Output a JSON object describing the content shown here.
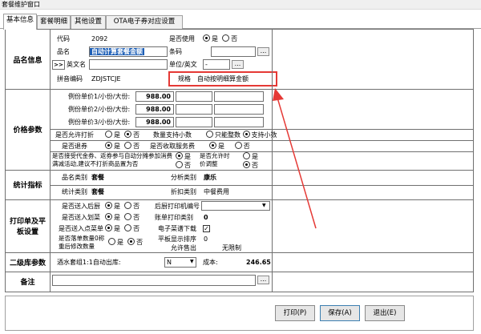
{
  "window": {
    "title": "套餐维护窗口"
  },
  "tabs": [
    "基本信息",
    "套餐明细",
    "其他设置",
    "OTA电子券对应设置"
  ],
  "sections": {
    "product": "品名信息",
    "price": "价格参数",
    "stats": "统计指标",
    "print": "打印单及平板设置",
    "stock": "二级库参数",
    "remark": "备注"
  },
  "product": {
    "code_label": "代码",
    "code_value": "2092",
    "name_label": "品名",
    "name_value": "自动计算套餐金额",
    "en_btn": ">>",
    "en_label": "英文名",
    "pinyin_label": "拼音编码",
    "pinyin_value": "ZDJSTCJE",
    "active_label": "是否使用",
    "active_yes": "是",
    "active_no": "否",
    "barcode_label": "条码",
    "unit_label": "单位/英文",
    "unit_value": "-",
    "spec_label": "规格",
    "spec_value": "自动按明细算金额"
  },
  "price": {
    "p1_label": "例份单价1/小份/大份:",
    "p1_value": "988.00",
    "p2_label": "例份单价2/小份/大份:",
    "p2_value": "988.00",
    "p3_label": "例份单价3/小份/大份:",
    "p3_value": "988.00",
    "discount_label": "是否允许打折",
    "yes": "是",
    "no": "否",
    "qty_label": "数量支持小数",
    "int_only": "只能整数",
    "support_decimal": "支持小数",
    "return_label": "是否退券",
    "service_label": "是否收取服务费",
    "coupon_label": "是否接受代金券、返券参与自动分摊参加消费满减活动,建议不打折商品置为否",
    "adjust_label": "是否允许时价调整"
  },
  "stats": {
    "cat_label": "品名类别",
    "cat_value": "套餐",
    "analysis_label": "分析类别",
    "analysis_value": "康乐",
    "stat_label": "统计类别",
    "stat_value": "套餐",
    "discount_cat_label": "折扣类别",
    "discount_cat_value": "中餐费用"
  },
  "print": {
    "kitchen_label": "是否送入后厨",
    "kitchen_printer_label": "后厨打印机编号",
    "handover_label": "是否送入划菜",
    "print_cat_label": "账单打印类别",
    "print_cat_value": "0",
    "order_label": "是否送入点菜单",
    "download_label": "电子菜谱下载",
    "nostock_label": "是否落单数量0称重后修改数量",
    "tablet_label": "平板显示排序",
    "tablet_value": "0",
    "sold_out_label": "允许售出",
    "sold_out_value": "无限制"
  },
  "stock": {
    "label": "酒水套组1:1自动出库:",
    "value": "N",
    "cost_label": "成本:",
    "cost_value": "246.65"
  },
  "buttons": {
    "print": "打印(P)",
    "save": "保存(A)",
    "exit": "退出(E)"
  },
  "annotation_color": "#e53935"
}
